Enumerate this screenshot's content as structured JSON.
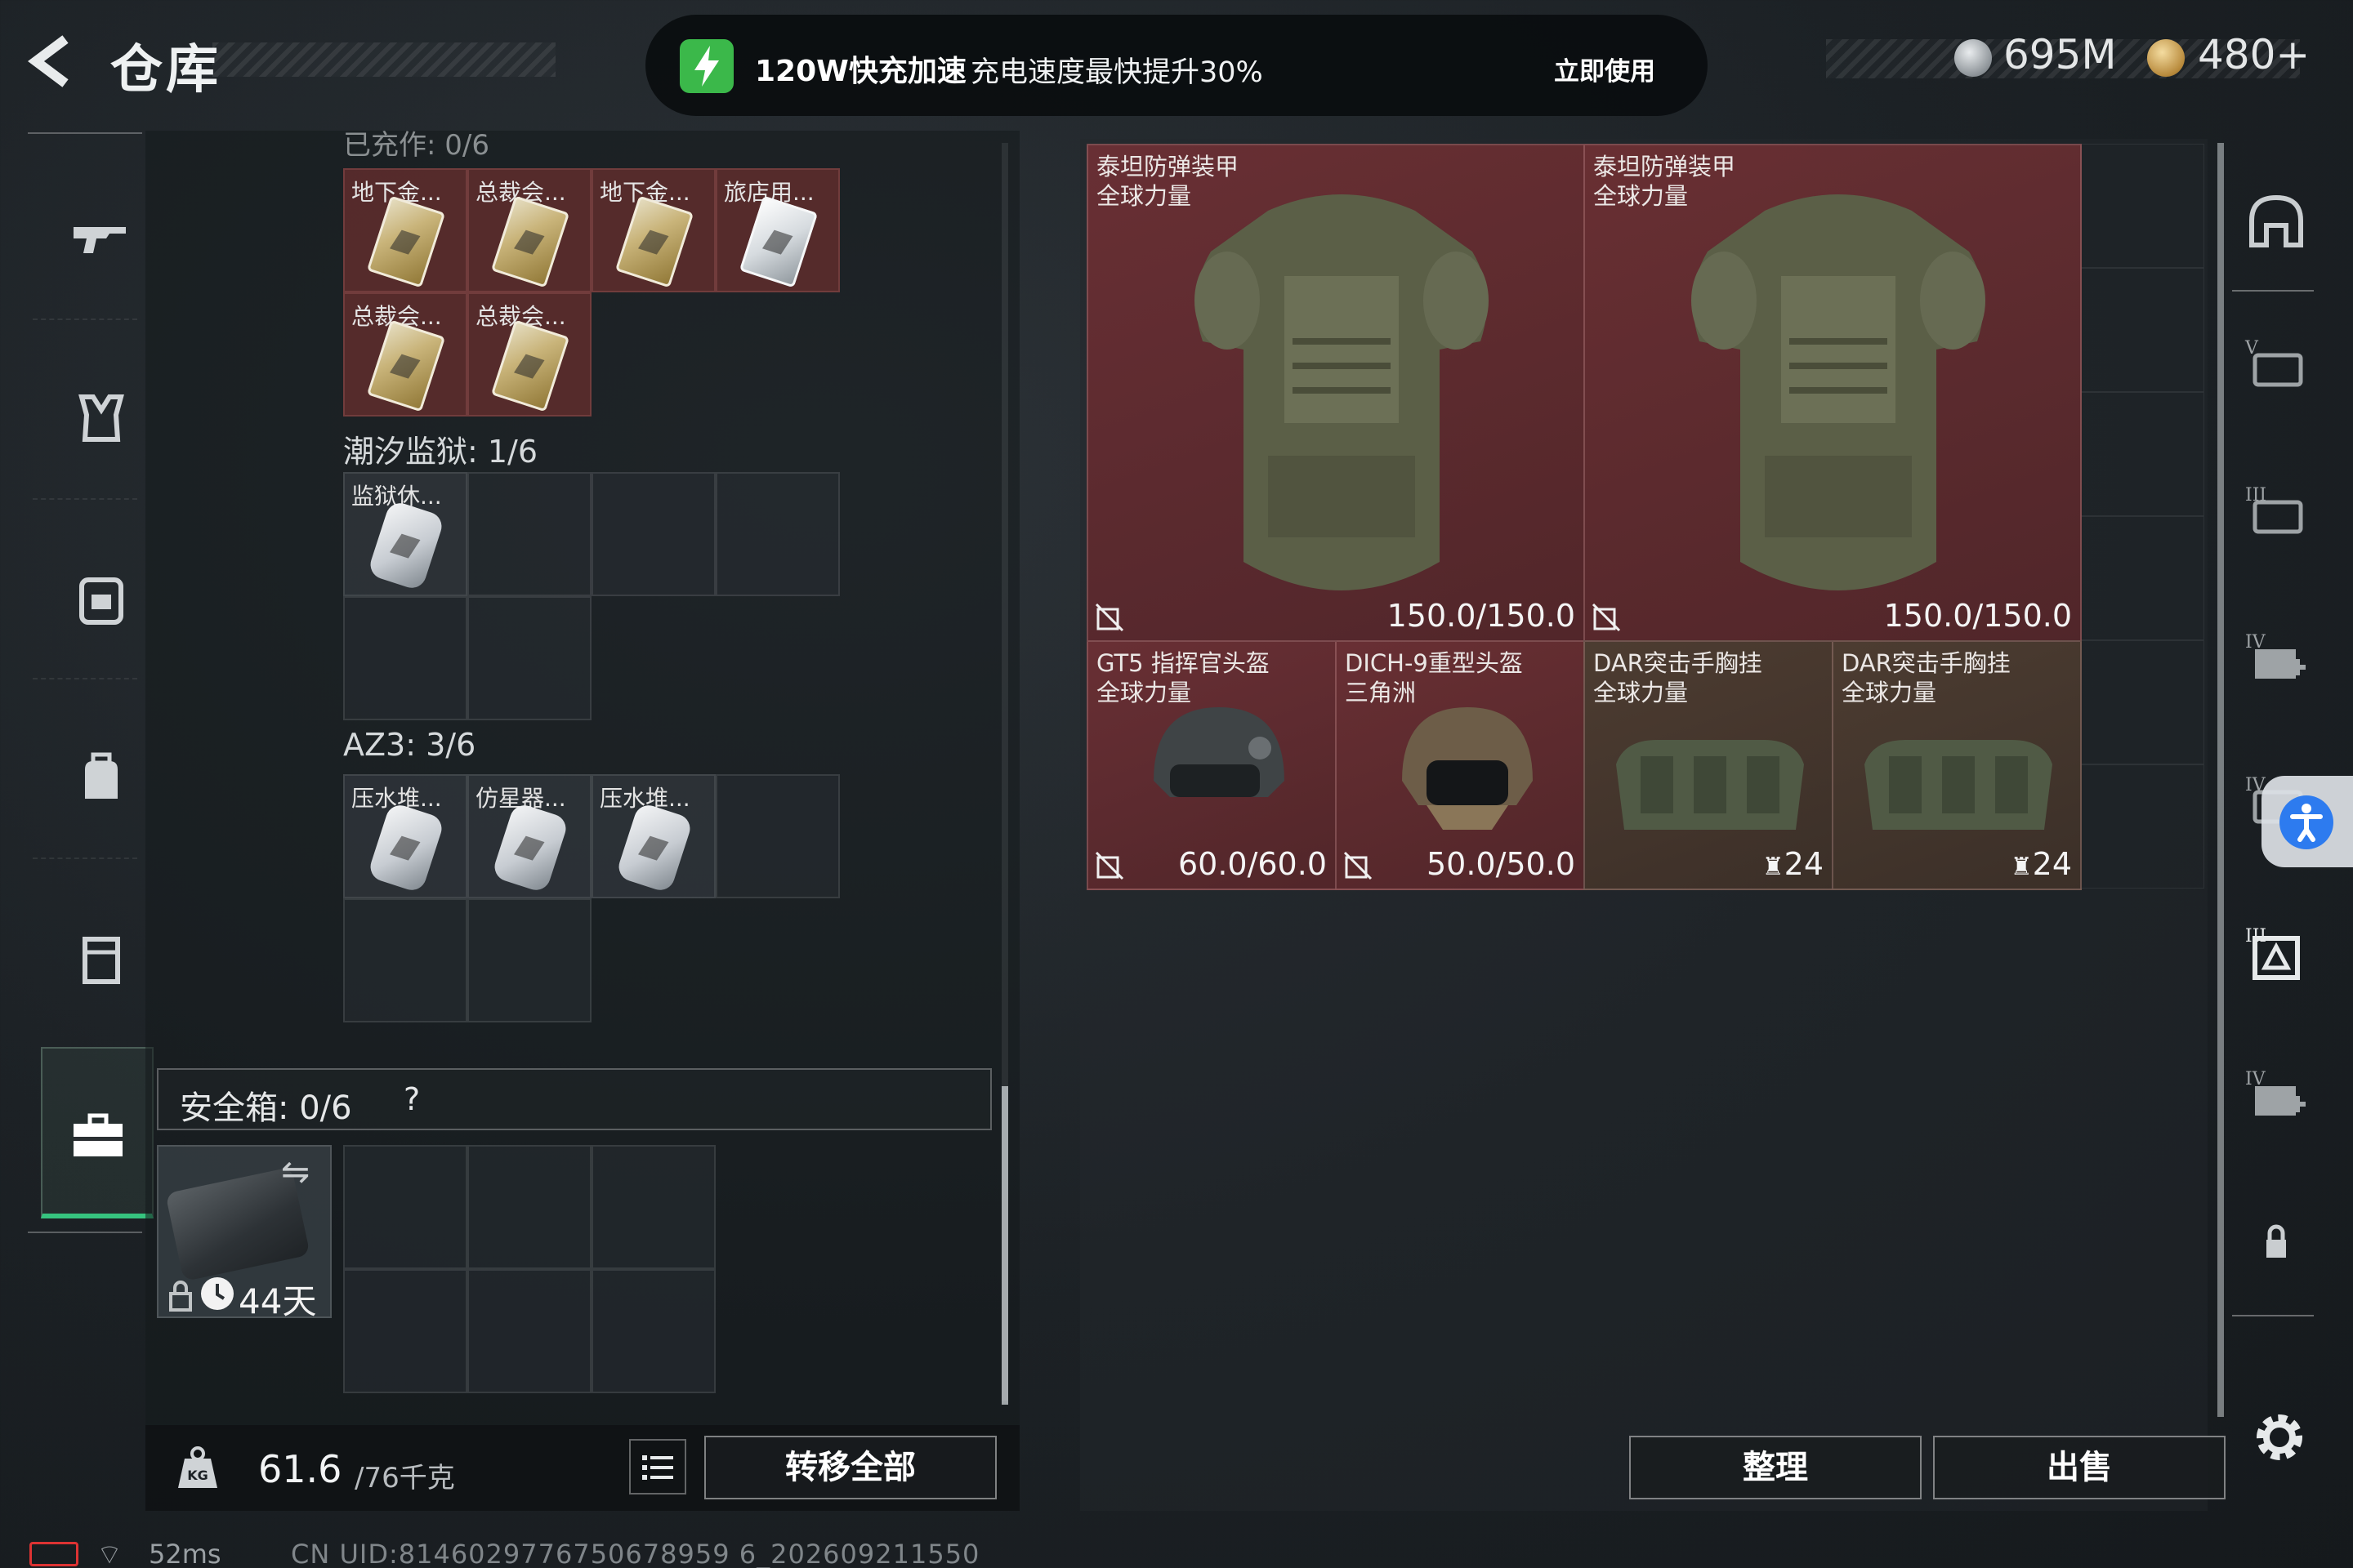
{
  "header": {
    "title": "仓库",
    "promo": {
      "title": "120W快充加速",
      "description": "充电速度最快提升30%",
      "action": "立即使用",
      "accent": "#3bb84a"
    },
    "currency": {
      "silver": "695M",
      "gold": "480+"
    }
  },
  "left_nav": {
    "icons": [
      "gun-icon",
      "vest-icon",
      "backpack-icon",
      "bag-icon",
      "container-icon",
      "toolbox-icon"
    ],
    "active_index": 5,
    "active_color": "#36c47f"
  },
  "collection": {
    "section_top_label": "已充作: 0/6",
    "row1": [
      "地下金...",
      "总裁会...",
      "地下金...",
      "旅店用..."
    ],
    "row2": [
      "总裁会...",
      "总裁会..."
    ],
    "prison_label": "潮汐监狱: 1/6",
    "prison_items": [
      "监狱休..."
    ],
    "az3_label": "AZ3: 3/6",
    "az3_items": [
      "压水堆...",
      "仿星器...",
      "压水堆..."
    ]
  },
  "safe": {
    "label": "安全箱: 0/6",
    "help": "?",
    "days": "44天"
  },
  "weight": {
    "current": "61.6",
    "total": "/76千克"
  },
  "buttons": {
    "transfer_all": "转移全部",
    "sort": "整理",
    "sell": "出售"
  },
  "inventory": {
    "items": [
      {
        "name": "泰坦防弹装甲",
        "sub": "全球力量",
        "value": "150.0/150.0",
        "kind": "armor"
      },
      {
        "name": "泰坦防弹装甲",
        "sub": "全球力量",
        "value": "150.0/150.0",
        "kind": "armor"
      },
      {
        "name": "GT5 指挥官头盔",
        "sub": "全球力量",
        "value": "60.0/60.0",
        "kind": "helmet"
      },
      {
        "name": "DICH-9重型头盔",
        "sub": "三角洲",
        "value": "50.0/50.0",
        "kind": "helmet"
      },
      {
        "name": "DAR突击手胸挂",
        "sub": "全球力量",
        "value": "24",
        "kind": "rig"
      },
      {
        "name": "DAR突击手胸挂",
        "sub": "全球力量",
        "value": "24",
        "kind": "rig"
      }
    ]
  },
  "right_rail": {
    "icons": [
      "helmet-slot-icon",
      "armor-v-icon",
      "armor-iii-icon",
      "medkit-iv-icon",
      "armor-iv-icon",
      "bag-iii-icon",
      "medkit-iv-icon",
      "lock-icon"
    ]
  },
  "status": {
    "ping": "52ms",
    "uid": "CN UID:8146029776750678959 6_202609211550"
  }
}
